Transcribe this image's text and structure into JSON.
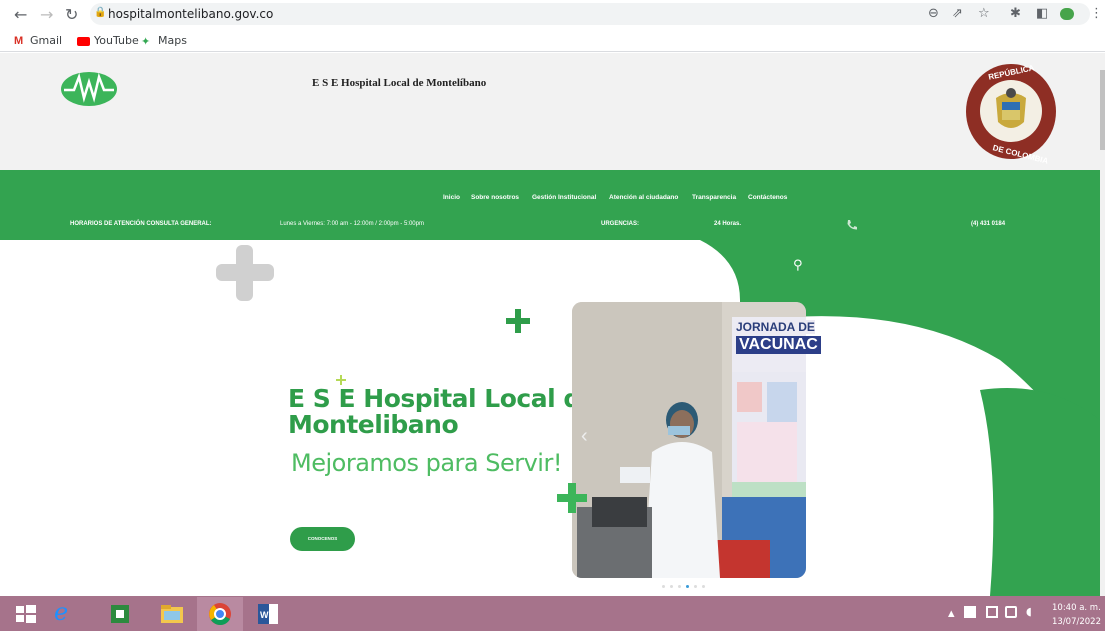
{
  "browser": {
    "url": "hospitalmontelibano.gov.co",
    "bookmarks": [
      "Gmail",
      "YouTube",
      "Maps"
    ]
  },
  "site": {
    "title": "E S E Hospital Local de Montelíbano",
    "seal_top": "REPÚBLICA",
    "seal_bottom": "DE COLOMBIA",
    "menu": [
      "Inicio",
      "Sobre nosotros",
      "Gestión Institucional",
      "Atención al ciudadano",
      "Transparencia",
      "Contáctenos"
    ],
    "info": {
      "hours_label": "HORARIOS DE ATENCIÓN CONSULTA GENERAL:",
      "hours_value": "Lunes a Viernes: 7:00 am - 12:00m / 2:00pm - 5:00pm",
      "urgent_label": "URGENCIAS:",
      "urgent_value": "24 Horas.",
      "phone": "(4) 431 0184"
    },
    "hero": {
      "title_line1": "E S E Hospital Local de",
      "title_line2": "Montelibano",
      "subtitle": "Mejoramos para Servir!",
      "button": "CONOCENOS"
    },
    "poster": {
      "line1": "JORNADA DE",
      "line2": "VACUNAC"
    },
    "slider_dots": 6,
    "slider_active": 3
  },
  "taskbar": {
    "time": "10:40 a. m.",
    "date": "13/07/2022"
  },
  "colors": {
    "green": "#33a350",
    "title_green": "#2f9d4a",
    "taskbar": "#a6738b"
  }
}
